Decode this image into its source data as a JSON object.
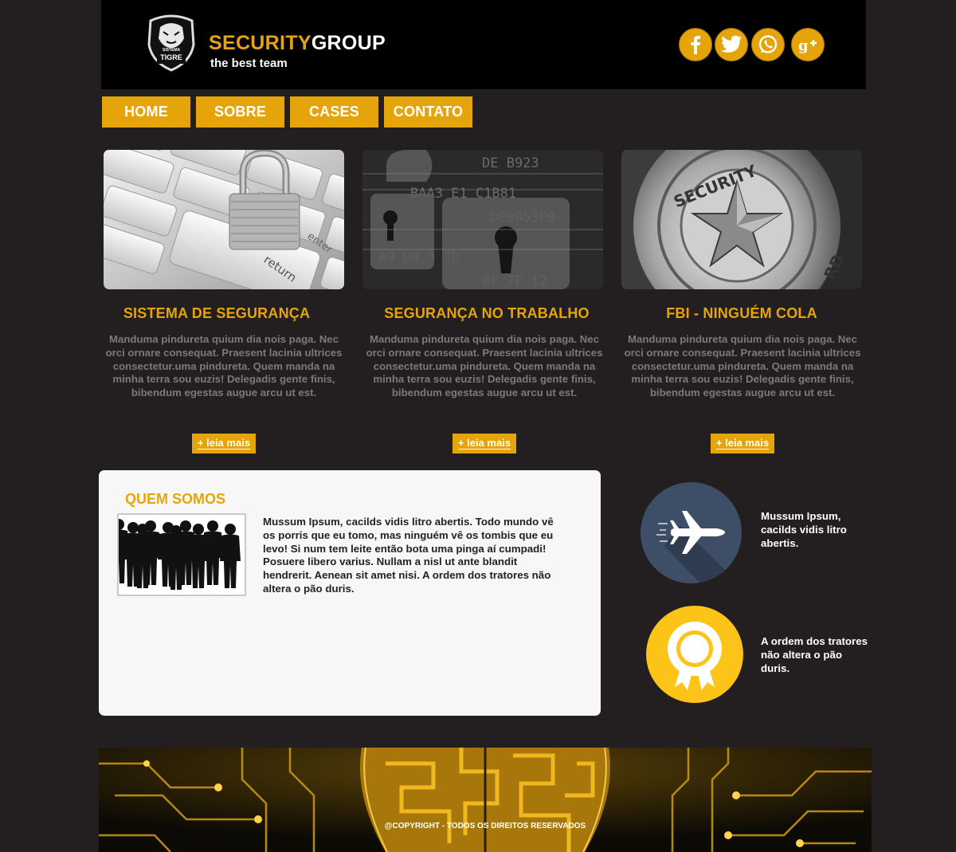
{
  "header": {
    "logo_text_top": "SISTEMA",
    "logo_text_bottom": "TIGRE",
    "brand_part1": "SECURITY",
    "brand_part2": "GROUP",
    "tagline": "the best team",
    "social": [
      {
        "name": "facebook",
        "icon": "facebook-icon"
      },
      {
        "name": "twitter",
        "icon": "twitter-icon"
      },
      {
        "name": "whatsapp",
        "icon": "whatsapp-icon"
      },
      {
        "name": "google-plus",
        "icon": "google-plus-icon"
      }
    ]
  },
  "nav": {
    "items": [
      "HOME",
      "SOBRE",
      "CASES",
      "CONTATO"
    ]
  },
  "cards": [
    {
      "title": "SISTEMA DE SEGURANÇA",
      "text": "Manduma pindureta quium dia nois paga. Nec orci ornare consequat. Praesent lacinia ultrices consectetur.uma pindureta. Quem manda na minha terra sou euzis! Delegadis gente finis, bibendum egestas augue arcu ut est.",
      "more": "+ leia mais",
      "image": "padlock-on-keyboard"
    },
    {
      "title": "SEGURANÇA NO TRABALHO",
      "text": "Manduma pindureta quium dia nois paga. Nec orci ornare consequat. Praesent lacinia ultrices consectetur.uma pindureta. Quem manda na minha terra sou euzis! Delegadis gente finis, bibendum egestas augue arcu ut est.",
      "more": "+ leia mais",
      "image": "digital-locks"
    },
    {
      "title": "FBI - NINGUÉM COLA",
      "text": "Manduma pindureta quium dia nois paga. Nec orci ornare consequat. Praesent lacinia ultrices consectetur.uma pindureta. Quem manda na minha terra sou euzis! Delegadis gente finis, bibendum egestas augue arcu ut est.",
      "more": "+ leia mais",
      "image": "security-badge"
    }
  ],
  "about": {
    "title": "QUEM SOMOS",
    "text": "Mussum Ipsum, cacilds vidis litro abertis. Todo mundo vê os porris que eu tomo, mas ninguém vê os tombis que eu levo! Si num tem leite então bota uma pinga aí cumpadi! Posuere libero varius. Nullam a nisl ut ante blandit hendrerit. Aenean sit amet nisi. A ordem dos tratores não altera o pão duris.",
    "image": "team-silhouettes"
  },
  "features": [
    {
      "icon": "airplane-icon",
      "text": "Mussum Ipsum, cacilds vidis litro abertis."
    },
    {
      "icon": "award-ribbon-icon",
      "text": "A ordem dos tratores não altera o pão duris."
    }
  ],
  "footer": {
    "copyright": "@COPYRIGHT - TODOS OS DIREITOS RESERVADOS"
  },
  "colors": {
    "accent": "#e6a40b",
    "background": "#231f20",
    "header_bg": "#000000",
    "panel_bg": "#f7f7f7"
  }
}
